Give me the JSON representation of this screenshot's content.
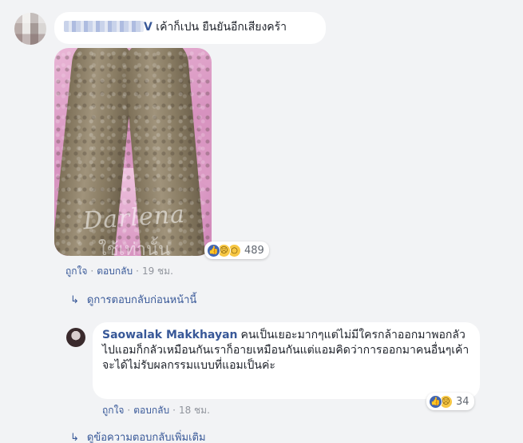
{
  "comment1": {
    "name_tail": "V",
    "text": "เค้าก็เปน ยืนยันอีกเสียงคร้า",
    "image": {
      "watermark_line1": "Darlena",
      "watermark_line2": "ใช้เท่านั้น"
    },
    "reaction_count": "489",
    "like_label": "ถูกใจ",
    "reply_label": "ตอบกลับ",
    "time": "19 ชม."
  },
  "previous_replies_link": "ดูการตอบกลับก่อนหน้านี้",
  "comment2": {
    "author": "Saowalak Makkhayan",
    "text": "คนเป็นเยอะมากๆแต่ไม่มีใครกล้าออกมาพอกลัวไปแอมก็กลัวเหมือนกันเราก็อายเหมือนกันแต่แอมคิดว่าการออกมาคนอื่นๆเค้าจะได้ไม่รับผลกรรมแบบที่แอมเป็นค่ะ",
    "reaction_count": "34",
    "like_label": "ถูกใจ",
    "reply_label": "ตอบกลับ",
    "time": "18 ชม."
  },
  "more_replies_link": "ดูข้อความตอบกลับเพิ่มเติม",
  "icons": {
    "like": "like-icon",
    "sad": "sad-icon",
    "wow": "wow-icon",
    "reply_arrow": "reply-arrow-icon"
  },
  "colors": {
    "link": "#385898",
    "background": "#f2f3f5",
    "like_blue": "#4267b2",
    "reaction_yellow": "#f7c744"
  }
}
